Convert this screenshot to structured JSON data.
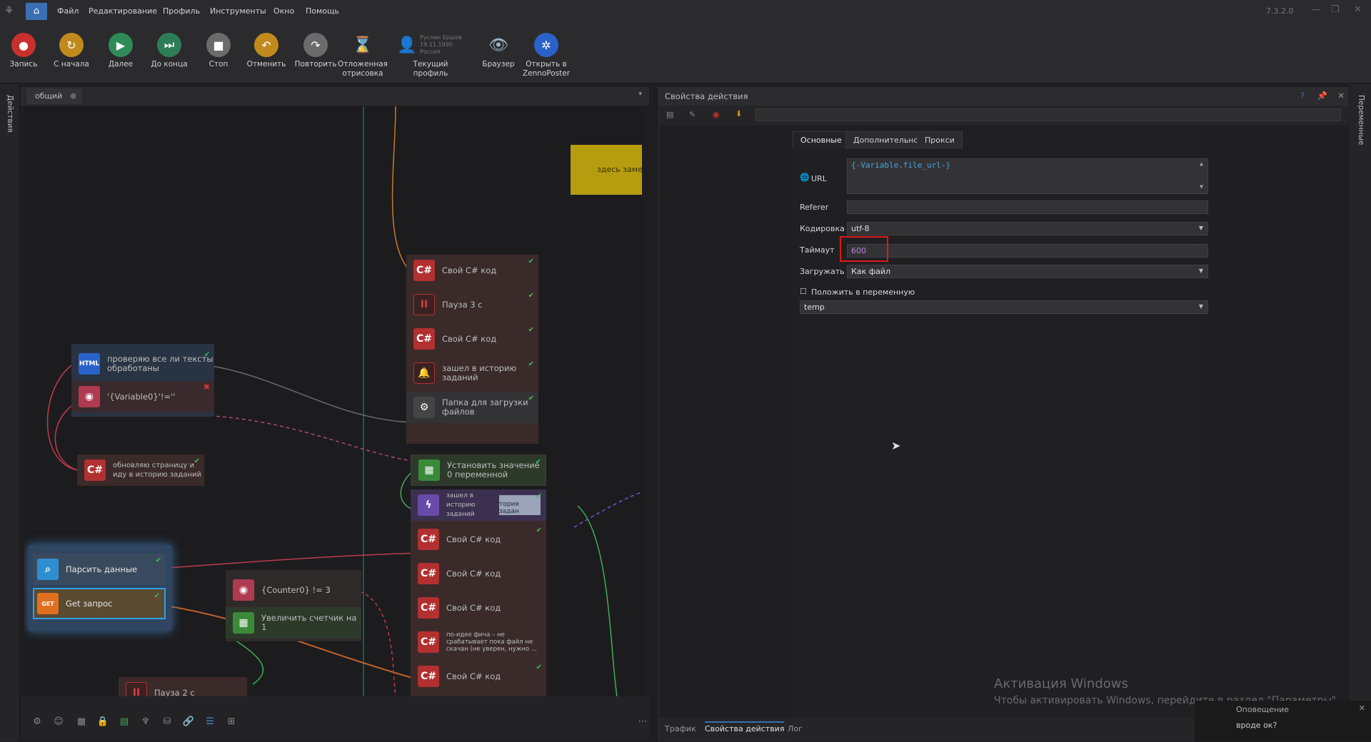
{
  "menubar": {
    "items": [
      "Файл",
      "Редактирование",
      "Профиль",
      "Инструменты",
      "Окно",
      "Помощь"
    ],
    "version": "7.3.2.0"
  },
  "toolbar": {
    "buttons": [
      {
        "label": "Запись",
        "icon": "record-icon",
        "color": "#c9302c"
      },
      {
        "label": "С начала",
        "icon": "restart-icon",
        "color": "#c28a1c"
      },
      {
        "label": "Далее",
        "icon": "play-icon",
        "color": "#2e8b57"
      },
      {
        "label": "До конца",
        "icon": "play-to-end-icon",
        "color": "#2e7d57"
      },
      {
        "label": "Стоп",
        "icon": "stop-icon",
        "color": "#6b6b6b"
      },
      {
        "label": "Отменить",
        "icon": "undo-icon",
        "color": "#c28a1c"
      },
      {
        "label": "Повторить",
        "icon": "redo-icon",
        "color": "#6b6b6b"
      },
      {
        "label": "Отложенная отрисовка",
        "icon": "hourglass-icon",
        "color": "#b5651d"
      },
      {
        "label": "Текущий профиль",
        "icon": "user-profile-icon",
        "color": "#8a5a3c"
      },
      {
        "label": "Браузер",
        "icon": "eye-icon",
        "color": "#5a6f80"
      },
      {
        "label": "Открыть в ZennoPoster",
        "icon": "zennoposter-icon",
        "color": "#2a62c9"
      }
    ],
    "profile_info": [
      "Руслан Ершов",
      "19.11.1990",
      "Россия"
    ]
  },
  "sidebars": {
    "left": "Действия",
    "right": "Переменные"
  },
  "document": {
    "tab": "общий"
  },
  "canvas": {
    "note_text": "здесь замен",
    "nodes_right": [
      {
        "text": "Свой C# код",
        "icon": "C#"
      },
      {
        "text": "Пауза 3 с",
        "icon": "II"
      },
      {
        "text": "Свой C# код",
        "icon": "C#"
      },
      {
        "text": "зашел в историю заданий",
        "icon": "bell"
      },
      {
        "text": "Папка для загрузки файлов",
        "icon": "gear"
      }
    ],
    "set_value": "Установить значение 0 переменной",
    "nodes_lower": [
      {
        "text": "зашел в историю заданий",
        "icon": "bolt",
        "tag": "тория задан"
      },
      {
        "text": "Свой C# код",
        "icon": "C#"
      },
      {
        "text": "Свой C# код",
        "icon": "C#"
      },
      {
        "text": "Свой C# код",
        "icon": "C#"
      },
      {
        "text": "по-идее фича – не срабатывает пока файл не скачан (не уверен, нужно ...",
        "icon": "C#"
      },
      {
        "text": "Свой C# код",
        "icon": "C#"
      }
    ],
    "html_node": "проверяю все ли тексты обработаны",
    "cond_node": "'{Variable0}'!=''",
    "refresh_node": "обновляю страницу и иду в историю заданий",
    "parse_node": "Парсить данные",
    "get_node": "Get запрос",
    "counter_node": "{Counter0} != 3",
    "inc_node": "Увеличить счетчик на 1",
    "pause2_node": "Пауза 2 с"
  },
  "props": {
    "title": "Свойства действия",
    "tabs": [
      "Основные",
      "Дополнительно",
      "Прокси"
    ],
    "url_label": "URL",
    "url_value": "{-Variable.file_url-}",
    "referer_label": "Referer",
    "referer_value": "",
    "encoding_label": "Кодировка",
    "encoding_value": "utf-8",
    "timeout_label": "Таймаут",
    "timeout_value": "600",
    "load_label": "Загружать",
    "load_value": "Как файл",
    "put_var_label": "Положить в переменную",
    "var_value": "temp"
  },
  "bottom_tabs": [
    "Трафик",
    "Свойства действия",
    "Лог"
  ],
  "watermark": {
    "line1": "Активация Windows",
    "line2": "Чтобы активировать Windows, перейдите в раздел \"Параметры\"."
  },
  "toast": {
    "title": "Оповещение",
    "text": "вроде ок?"
  }
}
